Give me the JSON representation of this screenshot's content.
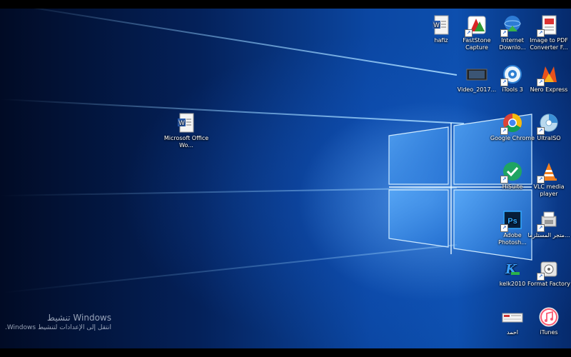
{
  "desktop": {
    "icons": [
      {
        "label": "hafiz",
        "icon": "word-document-icon"
      },
      {
        "label": "FastStone Capture",
        "icon": "faststone-capture-icon"
      },
      {
        "label": "Internet Downlo...",
        "icon": "internet-download-manager-icon"
      },
      {
        "label": "Image to PDF Converter F...",
        "icon": "image-to-pdf-icon"
      },
      {
        "label": "Video_2017...",
        "icon": "video-file-icon"
      },
      {
        "label": "iTools 3",
        "icon": "itools-icon"
      },
      {
        "label": "Nero Express",
        "icon": "nero-express-icon"
      },
      {
        "label": "Microsoft Office Wo...",
        "icon": "word-document-icon"
      },
      {
        "label": "Google Chrome",
        "icon": "chrome-icon"
      },
      {
        "label": "UltraISO",
        "icon": "ultraiso-icon"
      },
      {
        "label": "HiSuite",
        "icon": "hisuite-icon"
      },
      {
        "label": "VLC media player",
        "icon": "vlc-icon"
      },
      {
        "label": "Adobe Photosh...",
        "icon": "photoshop-icon"
      },
      {
        "label": "متجر المستلزما...",
        "icon": "store-icon"
      },
      {
        "label": "kelk2010",
        "icon": "kelk-icon"
      },
      {
        "label": "Format Factory",
        "icon": "format-factory-icon"
      },
      {
        "label": "احمد",
        "icon": "file-icon"
      },
      {
        "label": "iTunes",
        "icon": "itunes-icon"
      }
    ]
  },
  "activation": {
    "title": "تنشيط Windows",
    "subtitle": "انتقل إلى الإعدادات لتنشيط Windows."
  },
  "colors": {
    "wallpaper_dark": "#010b25",
    "wallpaper_mid": "#0b47a3",
    "logo_glow": "#9fd4ff"
  }
}
